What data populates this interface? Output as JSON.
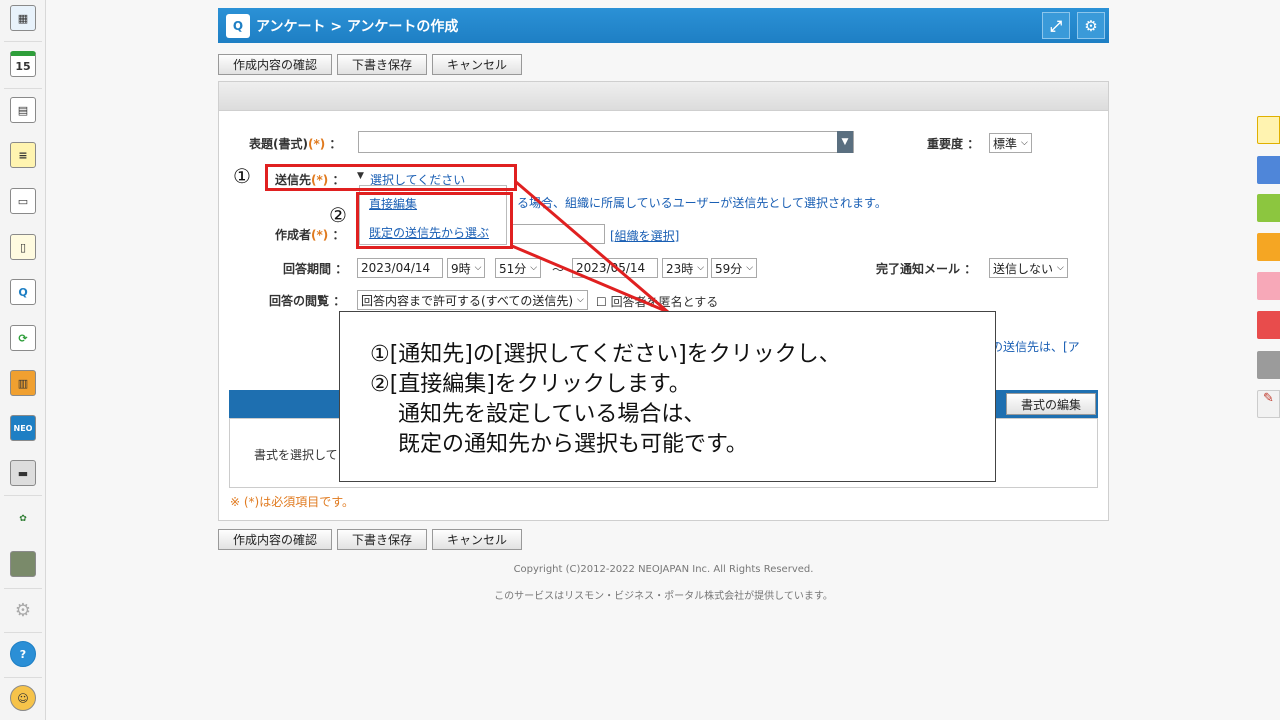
{
  "titlebar": {
    "title": "アンケート > アンケートの作成",
    "expand_icon": "expand-icon",
    "settings_icon": "gear-icon"
  },
  "toolbar": {
    "confirm_label": "作成内容の確認",
    "draft_label": "下書き保存",
    "cancel_label": "キャンセル"
  },
  "form": {
    "subject_label": "表題(書式)",
    "required_mark": "(*)",
    "colon": "：",
    "priority_label": "重要度",
    "priority_value": "標準",
    "recipient_label": "送信先",
    "recipient_link": "選択してください",
    "dropdown_direct": "直接編集",
    "dropdown_preset": "既定の送信先から選ぶ",
    "recipient_note": "る場合、組織に所属しているユーザーが送信先として選択されます。",
    "author_label": "作成者",
    "org_select_link": "[組織を選択]",
    "period_label": "回答期間",
    "start_date": "2023/04/14",
    "start_hour": "9時",
    "start_min": "51分",
    "tilde": "～",
    "end_date": "2023/05/14",
    "end_hour": "23時",
    "end_min": "59分",
    "notify_label": "完了通知メール",
    "notify_value": "送信しない",
    "view_label": "回答の閲覧",
    "view_value": "回答内容まで許可する(すべての送信先)",
    "anonymous_label": "回答者を匿名とする",
    "right_note": "の送信先は、[ア",
    "edit_format_button": "書式の編集",
    "select_format_text": "書式を選択して",
    "required_note": "※ (*)は必須項目です。"
  },
  "footer": {
    "copyright": "Copyright (C)2012-2022 NEOJAPAN Inc. All Rights Reserved.",
    "provider": "このサービスはリスモン・ビジネス・ポータル株式会社が提供しています。"
  },
  "annotation": {
    "marker1": "①",
    "marker2": "②",
    "line1": "①[通知先]の[選択してください]をクリックし、",
    "line2": "②[直接編集]をクリックします。",
    "line3": "通知先を設定している場合は、",
    "line4": "既定の通知先から選択も可能です。"
  },
  "sidebar": {
    "items": [
      "portal-icon",
      "calendar-icon",
      "report-icon",
      "memo-icon",
      "document-icon",
      "notepad-icon",
      "survey-icon",
      "refresh-icon",
      "cabinet-icon",
      "neo-icon",
      "folder-icon",
      "logo-icon",
      "photo-icon",
      "gear-icon",
      "help-icon",
      "support-icon"
    ],
    "calendar_day": "15"
  },
  "colors": {
    "accent": "#1e7fc4",
    "annotation_red": "#e02020"
  }
}
